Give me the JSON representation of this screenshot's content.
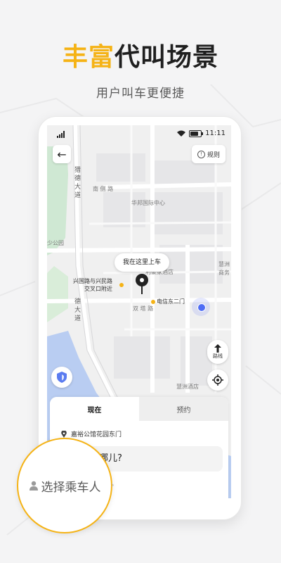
{
  "promo": {
    "headline_highlight": "丰富",
    "headline_rest": "代叫场景",
    "subtitle": "用户叫车更便捷"
  },
  "status_bar": {
    "time": "11:11"
  },
  "map": {
    "rules_label": "规则",
    "road_labels": {
      "yinde": "猎德大道",
      "nancang": "南 侧 路",
      "huabang": "华邦国际中心",
      "shaogongyuan": "少公园",
      "shuangta": "双 塔 路",
      "huizhou_top": "慧洲",
      "huizhou_top2": "商务",
      "yinde2": "德大道",
      "huizhou_hotel": "慧洲酒店",
      "hotel_mid": "利豪家酒店"
    },
    "pickup_bubble": "我在这里上车",
    "stations": [
      {
        "label_line1": "兴国路与兴民路",
        "label_line2": "交叉口附近"
      },
      {
        "label_line1": "电信东二门"
      }
    ],
    "route_label": "路线"
  },
  "panel": {
    "tabs": [
      {
        "label": "现在",
        "active": true
      },
      {
        "label": "预约",
        "active": false
      }
    ],
    "start_location": "嘉裕公馆花园东门",
    "destination_prompt": "哪儿?"
  },
  "passenger_selector": {
    "label": "选择乘车人"
  },
  "colors": {
    "accent": "#f5b316",
    "location": "#4f6df5"
  }
}
